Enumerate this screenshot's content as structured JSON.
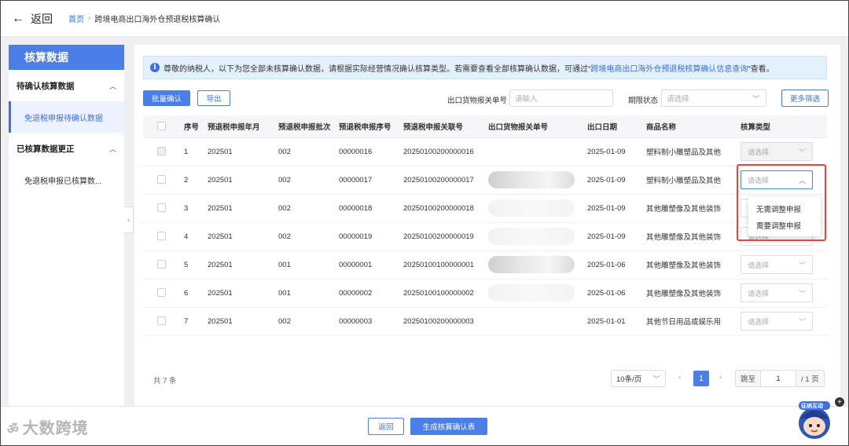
{
  "header": {
    "back_label": "返回",
    "breadcrumb": {
      "home": "首页",
      "current": "跨境电商出口海外仓预退税核算确认"
    }
  },
  "sidebar": {
    "title": "核算数据",
    "groups": [
      {
        "label": "待确认核算数据",
        "items": [
          "免退税申报待确认数据"
        ]
      },
      {
        "label": "已核算数据更正",
        "items": [
          "免退税申报已核算数..."
        ]
      }
    ]
  },
  "notice": {
    "text_before": "尊敬的纳税人，以下为您全部未核算确认数据，请根据实际经营情况确认核算类型。若需要查看全部核算确认数据，可通过“",
    "link": "跨境电商出口海外仓预退税核算确认信息查询",
    "text_after": "”查看。"
  },
  "toolbar": {
    "batch_confirm": "批量确认",
    "export": "导出",
    "customs_label": "出口货物报关单号",
    "customs_placeholder": "请输入",
    "period_label": "期限状态",
    "period_placeholder": "请选择",
    "more_filter": "更多筛选"
  },
  "table": {
    "headers": [
      "序号",
      "预退税申报年月",
      "预退税申报批次",
      "预退税申报序号",
      "预退税申报关联号",
      "出口货物报关单号",
      "出口日期",
      "商品名称",
      "核算类型"
    ],
    "select_placeholder": "请选择",
    "rows": [
      {
        "no": "1",
        "ym": "202501",
        "batch": "002",
        "seq": "00000016",
        "link": "20250100200000016",
        "date": "2025-01-09",
        "name": "塑料制小雕塑品及其他"
      },
      {
        "no": "2",
        "ym": "202501",
        "batch": "002",
        "seq": "00000017",
        "link": "20250100200000017",
        "date": "2025-01-09",
        "name": "塑料制小雕塑品及其他"
      },
      {
        "no": "3",
        "ym": "202501",
        "batch": "002",
        "seq": "00000018",
        "link": "20250100200000018",
        "date": "2025-01-09",
        "name": "其他雕塑像及其他装饰"
      },
      {
        "no": "4",
        "ym": "202501",
        "batch": "002",
        "seq": "00000019",
        "link": "20250100200000019",
        "date": "2025-01-09",
        "name": "其他雕塑像及其他装饰"
      },
      {
        "no": "5",
        "ym": "202501",
        "batch": "001",
        "seq": "00000001",
        "link": "20250100100000001",
        "date": "2025-01-06",
        "name": "其他雕塑像及其他装饰"
      },
      {
        "no": "6",
        "ym": "202501",
        "batch": "001",
        "seq": "00000002",
        "link": "20250100100000002",
        "date": "2025-01-06",
        "name": "其他雕塑像及其他装饰"
      },
      {
        "no": "7",
        "ym": "202501",
        "batch": "002",
        "seq": "00000003",
        "link": "20250100200000003",
        "date": "2025-01-01",
        "name": "其他节日用品或娱乐用"
      }
    ],
    "dropdown_options": [
      "无需调整申报",
      "需要调整申报"
    ]
  },
  "pagination": {
    "total": "共 7 条",
    "page_size": "10条/页",
    "current_page": "1",
    "jump_label": "跳至",
    "jump_value": "1",
    "total_pages": "/ 1 页"
  },
  "footer": {
    "back": "返回",
    "generate": "生成核算确认表"
  },
  "watermark": "大数跨境",
  "mascot_text": "征纳互动",
  "colors": {
    "primary": "#4a7ee8",
    "highlight": "#e04a3b",
    "notice_bg": "#e3f1fb"
  }
}
